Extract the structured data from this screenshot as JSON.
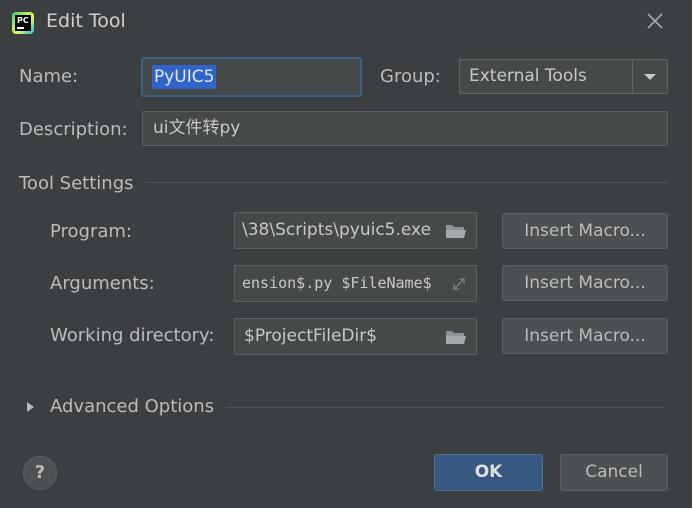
{
  "dialog": {
    "title": "Edit Tool",
    "app_icon_text": "PC",
    "close_icon": "close-icon"
  },
  "form": {
    "name_label": "Name:",
    "name_value": "PyUIC5",
    "group_label": "Group:",
    "group_value": "External Tools",
    "description_label": "Description:",
    "description_value": "ui文件转py"
  },
  "tool_settings": {
    "section_title": "Tool Settings",
    "program_label": "Program:",
    "program_value": "\\38\\Scripts\\pyuic5.exe",
    "arguments_label": "Arguments:",
    "arguments_value": "ension$.py $FileName$",
    "working_dir_label": "Working directory:",
    "working_dir_value": "$ProjectFileDir$",
    "insert_macro_label": "Insert Macro..."
  },
  "advanced": {
    "label": "Advanced Options",
    "expanded": false
  },
  "footer": {
    "help_label": "?",
    "ok_label": "OK",
    "cancel_label": "Cancel"
  },
  "colors": {
    "background": "#3c3f41",
    "field_bg": "#45494a",
    "selection": "#2f65ca",
    "focus_border": "#3d6185",
    "ok_button": "#365880"
  }
}
